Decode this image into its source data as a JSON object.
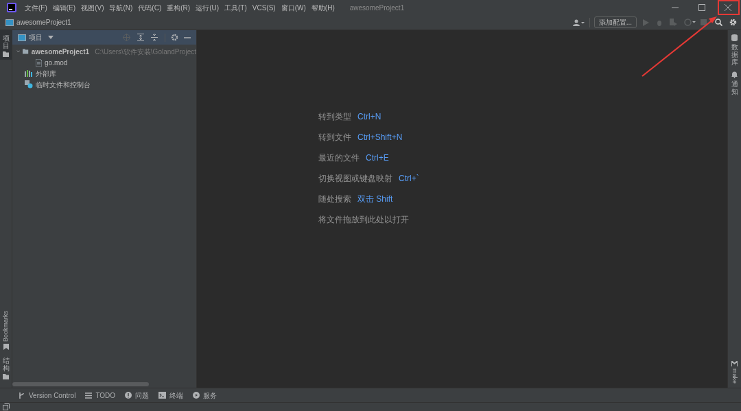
{
  "menu": [
    "文件(F)",
    "编辑(E)",
    "视图(V)",
    "导航(N)",
    "代码(C)",
    "重构(R)",
    "运行(U)",
    "工具(T)",
    "VCS(S)",
    "窗口(W)",
    "帮助(H)"
  ],
  "window": {
    "title": "awesomeProject1"
  },
  "breadcrumb": "awesomeProject1",
  "toolbar": {
    "config_button": "添加配置..."
  },
  "left_strip": [
    {
      "label": "项目",
      "kind": "cjk",
      "selected": true
    },
    {
      "label": "Bookmarks",
      "kind": "latin",
      "selected": false
    },
    {
      "label": "结构",
      "kind": "cjk",
      "selected": false
    }
  ],
  "project_panel": {
    "title": "项目",
    "tree": [
      {
        "label": "awesomeProject1",
        "path": "C:\\Users\\软件安装\\GolandProject",
        "kind": "folder",
        "expanded": true,
        "children": [
          {
            "label": "go.mod",
            "kind": "file"
          }
        ]
      },
      {
        "label": "外部库",
        "kind": "library"
      },
      {
        "label": "临时文件和控制台",
        "kind": "scratch"
      }
    ]
  },
  "welcome_hints": [
    {
      "label": "转到类型",
      "shortcut": "Ctrl+N"
    },
    {
      "label": "转到文件",
      "shortcut": "Ctrl+Shift+N"
    },
    {
      "label": "最近的文件",
      "shortcut": "Ctrl+E"
    },
    {
      "label": "切换视图或键盘映射",
      "shortcut": "Ctrl+`"
    },
    {
      "label": "随处搜索",
      "shortcut": "双击 Shift"
    },
    {
      "label": "将文件拖放到此处以打开"
    }
  ],
  "right_strip": [
    {
      "label": "数据库",
      "kind": "database"
    },
    {
      "label": "通知",
      "kind": "bell"
    }
  ],
  "right_strip_bottom": "make",
  "bottom_tools": [
    {
      "label": "Version Control",
      "kind": "vcs"
    },
    {
      "label": "TODO",
      "kind": "todo"
    },
    {
      "label": "问题",
      "kind": "problems"
    },
    {
      "label": "终端",
      "kind": "terminal"
    },
    {
      "label": "服务",
      "kind": "services"
    }
  ]
}
